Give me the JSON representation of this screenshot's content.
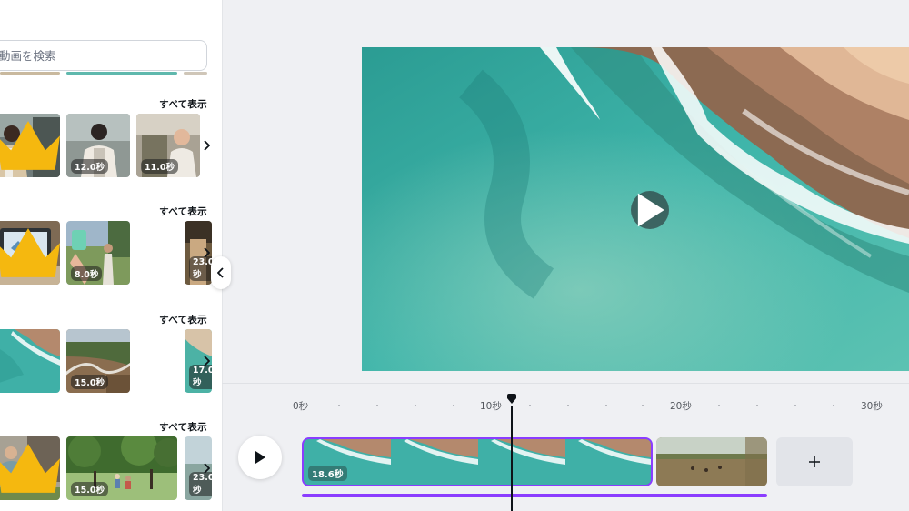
{
  "search": {
    "placeholder": "動画を検索"
  },
  "sections": [
    {
      "see_all": "すべて表示",
      "items": [
        {
          "duration": "",
          "premium": true
        },
        {
          "duration": "12.0秒",
          "premium": false
        },
        {
          "duration": "11.0秒",
          "premium": false
        }
      ]
    },
    {
      "see_all": "すべて表示",
      "items": [
        {
          "duration": "",
          "premium": true
        },
        {
          "duration": "8.0秒",
          "premium": false
        },
        {
          "duration": "23.0秒",
          "premium": false
        }
      ]
    },
    {
      "see_all": "すべて表示",
      "items": [
        {
          "duration": "",
          "premium": false
        },
        {
          "duration": "15.0秒",
          "premium": false
        },
        {
          "duration": "17.0秒",
          "premium": false
        }
      ]
    },
    {
      "see_all": "すべて表示",
      "items": [
        {
          "duration": "",
          "premium": true
        },
        {
          "duration": "15.0秒",
          "premium": false
        },
        {
          "duration": "23.0秒",
          "premium": false
        }
      ]
    }
  ],
  "timeline": {
    "ruler_labels": [
      "0秒",
      "10秒",
      "20秒",
      "30秒"
    ],
    "selected_clip_duration": "18.6秒",
    "add_label": "+"
  },
  "colors": {
    "accent": "#8b3dff",
    "playhead": "#0e1318"
  },
  "icons": {
    "play": "play-icon",
    "collapse": "chevron-left-icon",
    "scroll": "chevron-right-icon",
    "premium": "crown-icon"
  }
}
